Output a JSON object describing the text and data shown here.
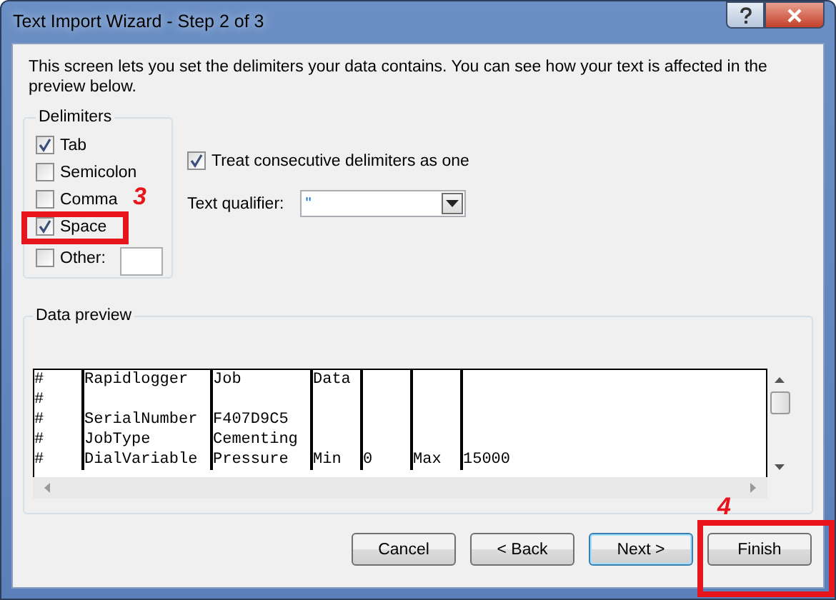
{
  "window": {
    "title": "Text Import Wizard - Step 2 of 3"
  },
  "description": "This screen lets you set the delimiters your data contains.  You can see how your text is affected in the preview below.",
  "delimiters": {
    "title": "Delimiters",
    "items": [
      {
        "label": "Tab",
        "checked": true
      },
      {
        "label": "Semicolon",
        "checked": false
      },
      {
        "label": "Comma",
        "checked": false
      },
      {
        "label": "Space",
        "checked": true
      },
      {
        "label": "Other:",
        "checked": false
      }
    ]
  },
  "consecutive": {
    "label": "Treat consecutive delimiters as one",
    "checked": true
  },
  "text_qualifier": {
    "label": "Text qualifier:",
    "value": "\""
  },
  "data_preview": {
    "title": "Data preview",
    "rows": [
      [
        "#",
        "Rapidlogger",
        "Job",
        "Data"
      ],
      [
        "#"
      ],
      [
        "#",
        "SerialNumber",
        "F407D9C5"
      ],
      [
        "#",
        "JobType",
        "Cementing"
      ],
      [
        "#",
        "DialVariable",
        "Pressure",
        "Min",
        "0",
        "Max",
        "15000"
      ]
    ]
  },
  "buttons": [
    {
      "label": "Cancel",
      "default": false
    },
    {
      "label": "< Back",
      "default": false
    },
    {
      "label": "Next >",
      "default": true
    },
    {
      "label": "Finish",
      "default": false
    }
  ],
  "annotations": [
    {
      "label": "3"
    },
    {
      "label": "4"
    }
  ]
}
